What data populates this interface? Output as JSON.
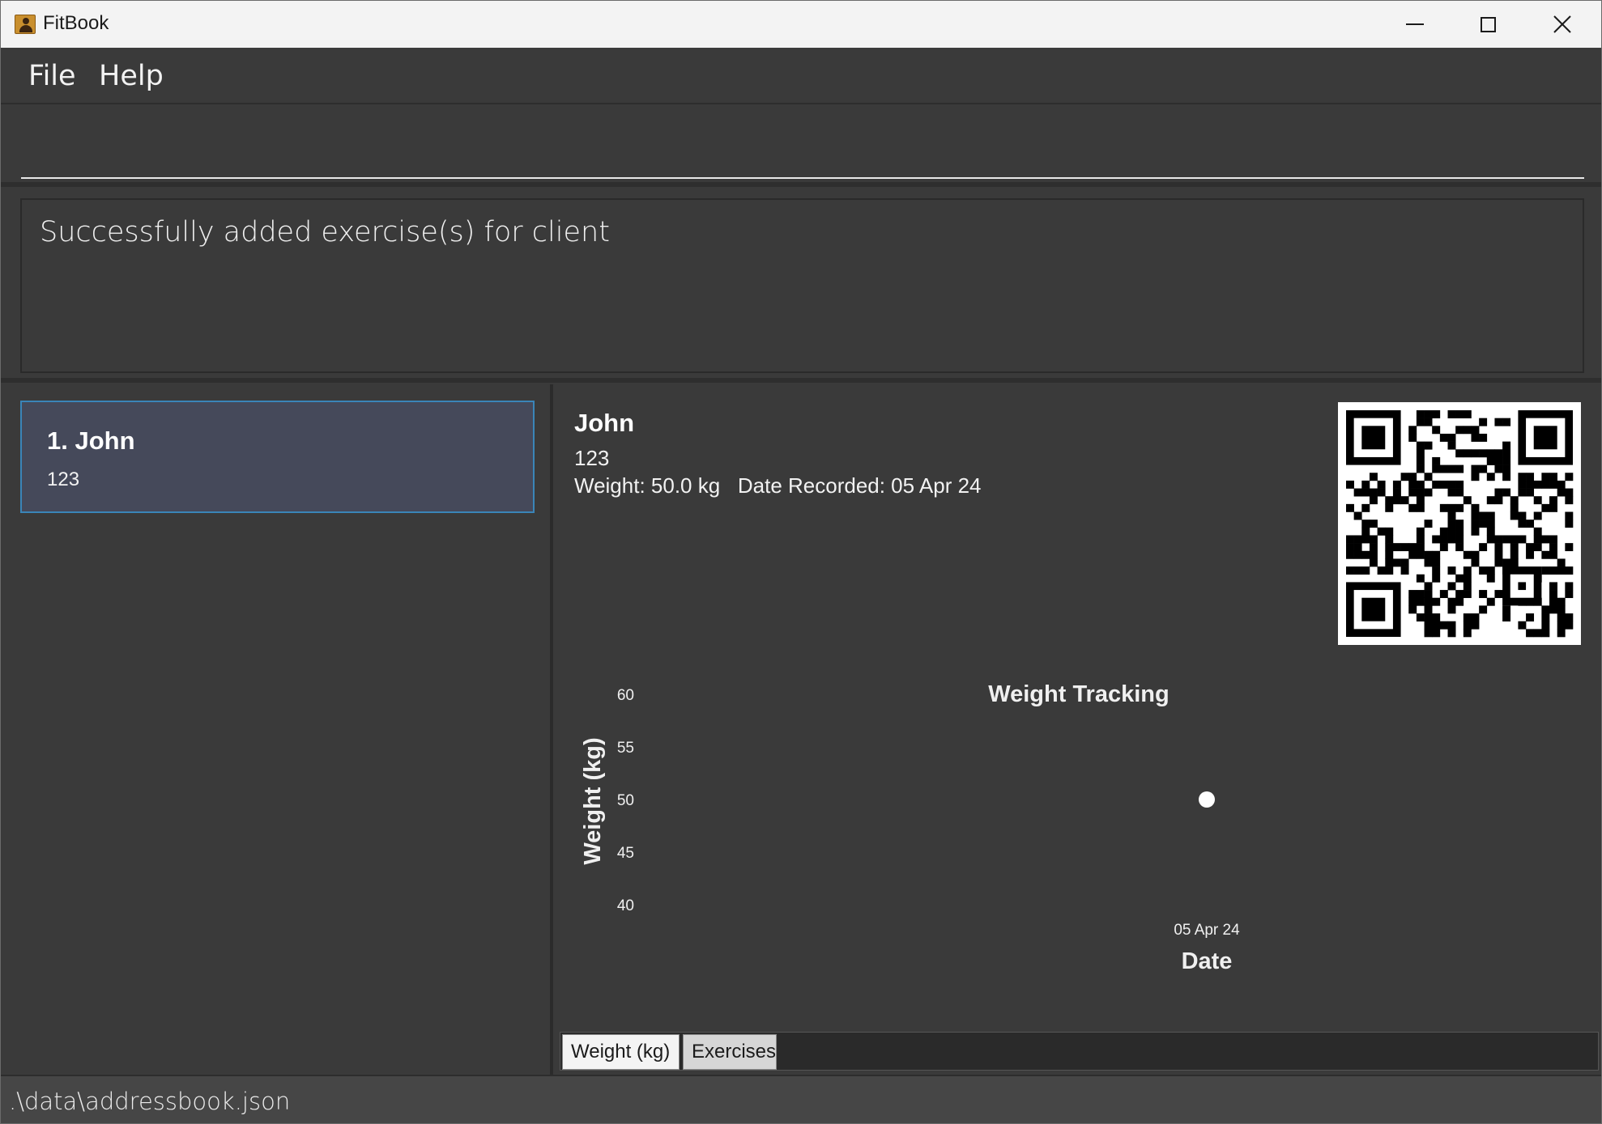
{
  "window": {
    "title": "FitBook"
  },
  "menu": {
    "file": "File",
    "help": "Help"
  },
  "command": {
    "value": "",
    "placeholder": ""
  },
  "result": {
    "message": "Successfully added exercise(s) for client"
  },
  "client_list": {
    "items": [
      {
        "name": "1. John",
        "phone": "123"
      }
    ]
  },
  "detail": {
    "name": "John",
    "phone": "123",
    "weight_line": "Weight: 50.0 kg   Date Recorded: 05 Apr 24"
  },
  "qr": {
    "icon": "qr-code-icon"
  },
  "chart_data": {
    "type": "scatter",
    "title": "Weight Tracking",
    "xlabel": "Date",
    "ylabel": "Weight (kg)",
    "categories": [
      "05 Apr 24"
    ],
    "values": [
      50
    ],
    "ylim": [
      40,
      60
    ],
    "yticks": [
      "60",
      "55",
      "50",
      "45",
      "40"
    ],
    "point_color": "#ffffff",
    "grid": false,
    "legend": false
  },
  "tabs": {
    "weight": "Weight (kg)",
    "exercises": "Exercises"
  },
  "status": {
    "path": ".\\data\\addressbook.json"
  },
  "colors": {
    "background": "#3a3a3a",
    "card_selected": "#45495a",
    "card_border": "#3a85b8"
  }
}
